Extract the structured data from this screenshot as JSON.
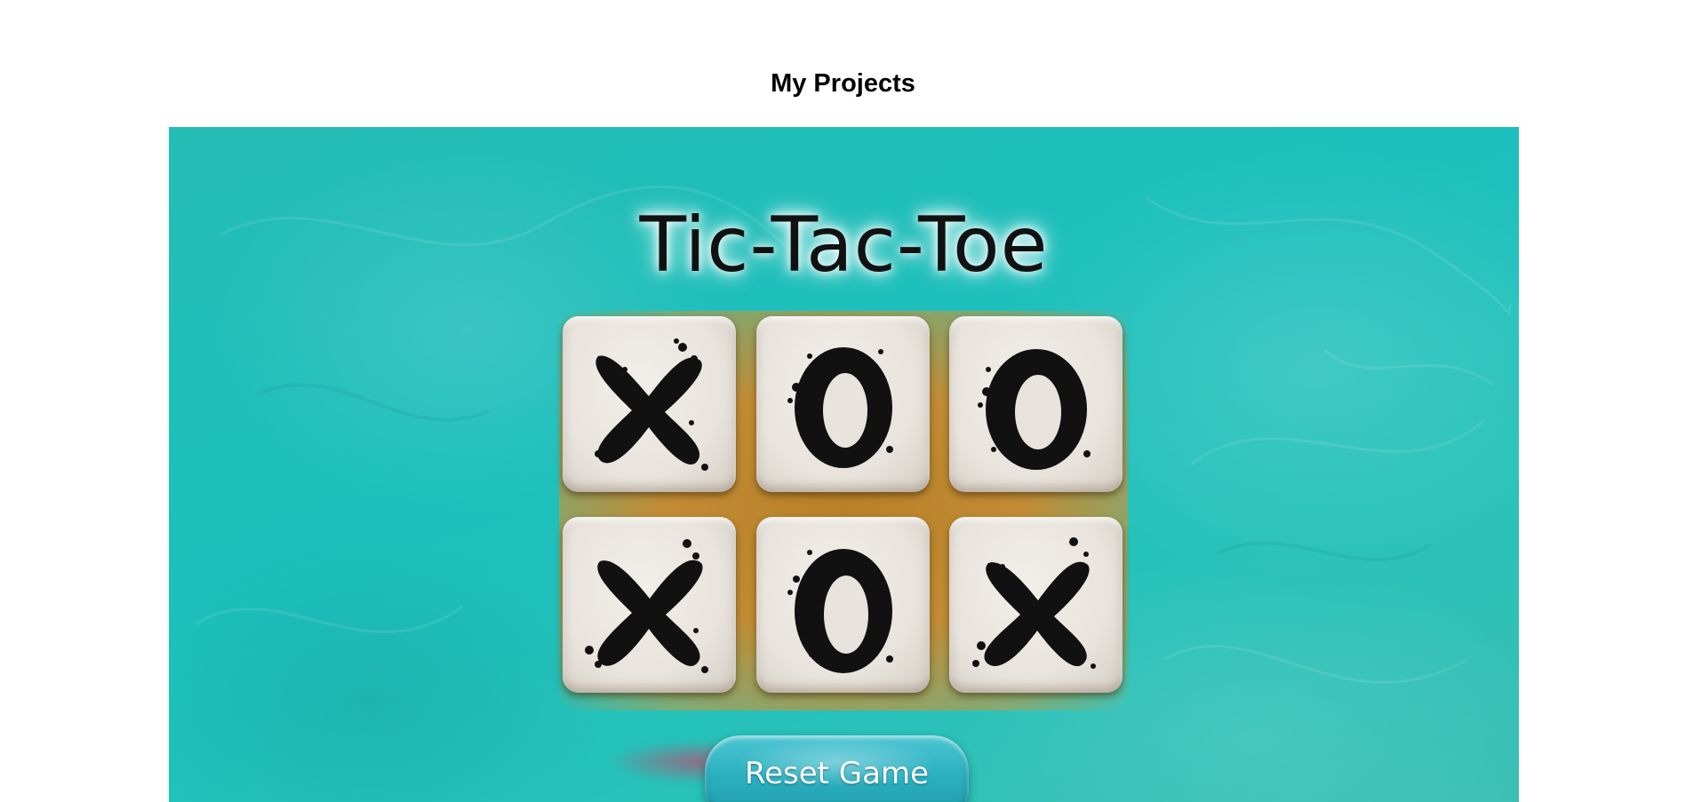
{
  "page": {
    "heading": "My Projects"
  },
  "project": {
    "game_title": "Tic-Tac-Toe",
    "reset_label": "Reset Game",
    "board": [
      [
        "X",
        "O",
        "O"
      ],
      [
        "X",
        "O",
        "X"
      ]
    ],
    "colors": {
      "background": "#1cbfbc",
      "board": "#c28c34",
      "tile": "#e8e3dc",
      "ink": "#111111",
      "button": "#2bb0c0"
    }
  }
}
